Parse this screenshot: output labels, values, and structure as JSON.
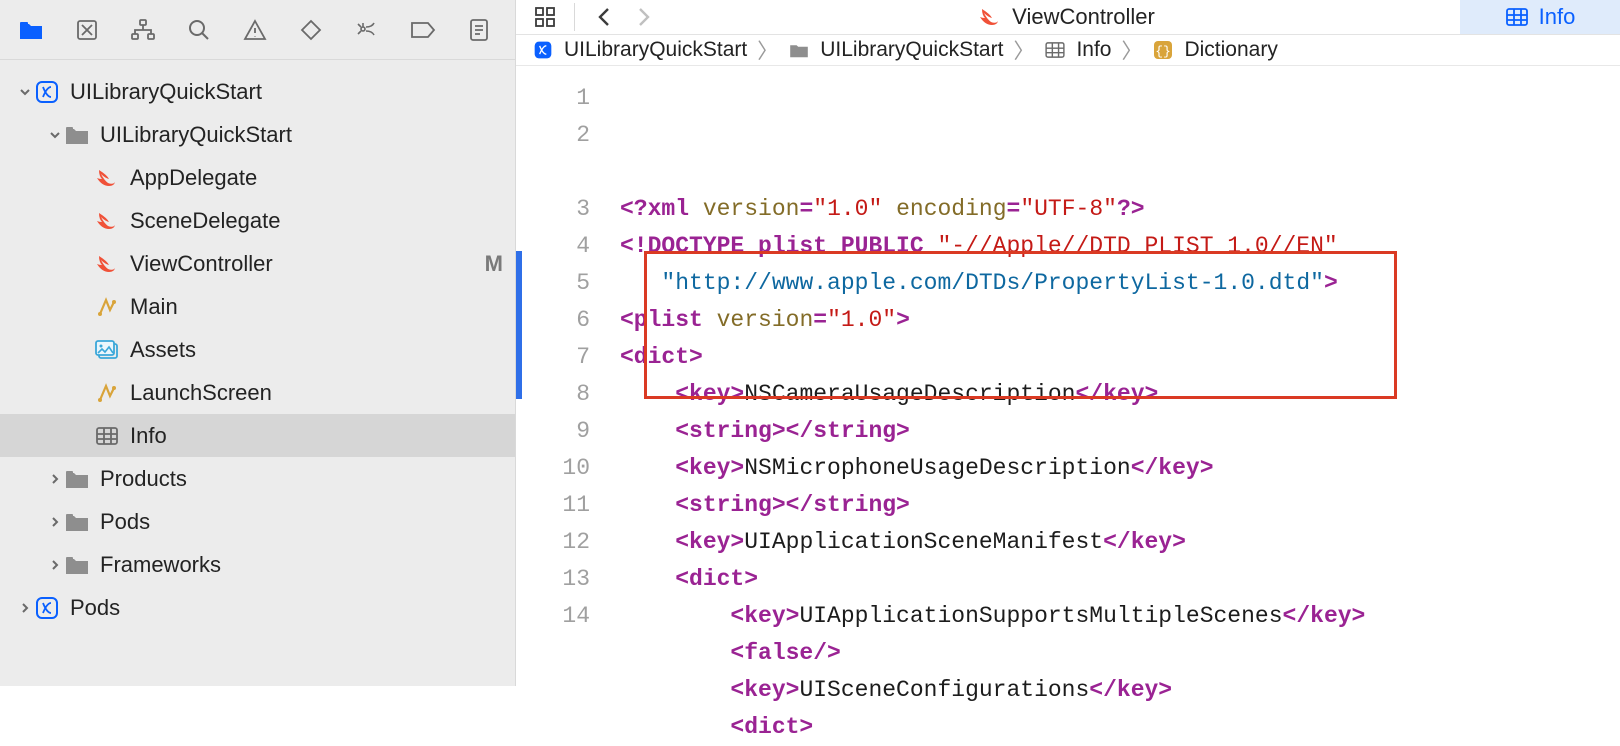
{
  "sidebar": {
    "root": {
      "label": "UILibraryQuickStart",
      "children": {
        "group": {
          "label": "UILibraryQuickStart",
          "items": [
            {
              "label": "AppDelegate",
              "icon": "swift",
              "status": ""
            },
            {
              "label": "SceneDelegate",
              "icon": "swift",
              "status": ""
            },
            {
              "label": "ViewController",
              "icon": "swift",
              "status": "M"
            },
            {
              "label": "Main",
              "icon": "storyboard",
              "status": ""
            },
            {
              "label": "Assets",
              "icon": "assets",
              "status": ""
            },
            {
              "label": "LaunchScreen",
              "icon": "storyboard",
              "status": ""
            },
            {
              "label": "Info",
              "icon": "plist",
              "status": ""
            }
          ]
        },
        "products": {
          "label": "Products"
        },
        "pods": {
          "label": "Pods"
        },
        "frameworks": {
          "label": "Frameworks"
        }
      }
    },
    "podsProject": {
      "label": "Pods"
    }
  },
  "tabs": {
    "vc": {
      "label": "ViewController",
      "icon": "swift"
    },
    "info": {
      "label": "Info",
      "icon": "plist"
    }
  },
  "breadcrumb": {
    "project": "UILibraryQuickStart",
    "folder": "UILibraryQuickStart",
    "file": "Info",
    "node": "Dictionary"
  },
  "code": {
    "lines": [
      [
        {
          "t": "<?xml ",
          "c": "decl"
        },
        {
          "t": "version",
          "c": "attr"
        },
        {
          "t": "=",
          "c": "punc"
        },
        {
          "t": "\"1.0\"",
          "c": "str"
        },
        {
          "t": " encoding",
          "c": "attr"
        },
        {
          "t": "=",
          "c": "punc"
        },
        {
          "t": "\"UTF-8\"",
          "c": "str"
        },
        {
          "t": "?>",
          "c": "decl"
        }
      ],
      [
        {
          "t": "<!DOCTYPE plist PUBLIC ",
          "c": "decl"
        },
        {
          "t": "\"-//Apple//DTD PLIST 1.0//EN\"",
          "c": "str"
        }
      ],
      [
        {
          "t": "   ",
          "c": "text"
        },
        {
          "t": "\"http://www.apple.com/DTDs/PropertyList-1.0.dtd\"",
          "c": "url"
        },
        {
          "t": ">",
          "c": "decl"
        }
      ],
      [
        {
          "t": "<plist ",
          "c": "tag"
        },
        {
          "t": "version",
          "c": "attr"
        },
        {
          "t": "=",
          "c": "punc"
        },
        {
          "t": "\"1.0\"",
          "c": "str"
        },
        {
          "t": ">",
          "c": "tag"
        }
      ],
      [
        {
          "t": "<dict>",
          "c": "tag"
        }
      ],
      [
        {
          "t": "    ",
          "c": "text"
        },
        {
          "t": "<key>",
          "c": "tag"
        },
        {
          "t": "NSCameraUsageDescription",
          "c": "text"
        },
        {
          "t": "</key>",
          "c": "tag"
        }
      ],
      [
        {
          "t": "    ",
          "c": "text"
        },
        {
          "t": "<string></string>",
          "c": "tag"
        }
      ],
      [
        {
          "t": "    ",
          "c": "text"
        },
        {
          "t": "<key>",
          "c": "tag"
        },
        {
          "t": "NSMicrophoneUsageDescription",
          "c": "text"
        },
        {
          "t": "</key>",
          "c": "tag"
        }
      ],
      [
        {
          "t": "    ",
          "c": "text"
        },
        {
          "t": "<string></string>",
          "c": "tag"
        }
      ],
      [
        {
          "t": "    ",
          "c": "text"
        },
        {
          "t": "<key>",
          "c": "tag"
        },
        {
          "t": "UIApplicationSceneManifest",
          "c": "text"
        },
        {
          "t": "</key>",
          "c": "tag"
        }
      ],
      [
        {
          "t": "    ",
          "c": "text"
        },
        {
          "t": "<dict>",
          "c": "tag"
        }
      ],
      [
        {
          "t": "        ",
          "c": "text"
        },
        {
          "t": "<key>",
          "c": "tag"
        },
        {
          "t": "UIApplicationSupportsMultipleScenes",
          "c": "text"
        },
        {
          "t": "</key>",
          "c": "tag"
        }
      ],
      [
        {
          "t": "        ",
          "c": "text"
        },
        {
          "t": "<false/>",
          "c": "tag"
        }
      ],
      [
        {
          "t": "        ",
          "c": "text"
        },
        {
          "t": "<key>",
          "c": "tag"
        },
        {
          "t": "UISceneConfigurations",
          "c": "text"
        },
        {
          "t": "</key>",
          "c": "tag"
        }
      ],
      [
        {
          "t": "        ",
          "c": "text"
        },
        {
          "t": "<dict>",
          "c": "tag"
        }
      ]
    ],
    "firstLineNo": 1,
    "line2Wraps": true
  }
}
